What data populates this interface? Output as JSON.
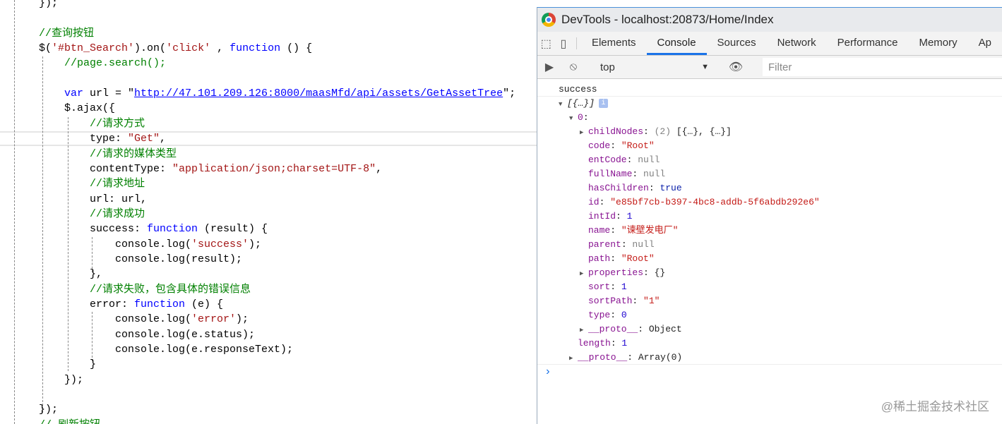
{
  "editor": {
    "lines": [
      {
        "indent": 0,
        "tokens": [
          [
            "",
            "});"
          ]
        ]
      },
      {
        "indent": 0,
        "tokens": []
      },
      {
        "indent": 0,
        "tokens": [
          [
            "cm",
            "//查询按钮"
          ]
        ]
      },
      {
        "indent": 0,
        "tokens": [
          [
            "",
            "$("
          ],
          [
            "str",
            "'#btn_Search'"
          ],
          [
            "",
            ").on("
          ],
          [
            "str",
            "'click'"
          ],
          [
            "",
            " , "
          ],
          [
            "kw",
            "function"
          ],
          [
            "",
            " () {"
          ]
        ]
      },
      {
        "indent": 1,
        "tokens": [
          [
            "cm",
            "//page.search();"
          ]
        ]
      },
      {
        "indent": 1,
        "tokens": []
      },
      {
        "indent": 1,
        "tokens": [
          [
            "kw",
            "var"
          ],
          [
            "",
            " url = \""
          ],
          [
            "url",
            "http://47.101.209.126:8000/maasMfd/api/assets/GetAssetTree"
          ],
          [
            "",
            "\";"
          ]
        ]
      },
      {
        "indent": 1,
        "tokens": [
          [
            "",
            "$.ajax({"
          ]
        ]
      },
      {
        "indent": 2,
        "tokens": [
          [
            "cm",
            "//请求方式"
          ]
        ]
      },
      {
        "indent": 2,
        "tokens": [
          [
            "",
            "type: "
          ],
          [
            "str",
            "\"Get\""
          ],
          [
            "",
            ","
          ]
        ]
      },
      {
        "indent": 2,
        "tokens": [
          [
            "cm",
            "//请求的媒体类型"
          ]
        ]
      },
      {
        "indent": 2,
        "tokens": [
          [
            "",
            "contentType: "
          ],
          [
            "str",
            "\"application/json;charset=UTF-8\""
          ],
          [
            "",
            ","
          ]
        ]
      },
      {
        "indent": 2,
        "tokens": [
          [
            "cm",
            "//请求地址"
          ]
        ]
      },
      {
        "indent": 2,
        "tokens": [
          [
            "",
            "url: url,"
          ]
        ]
      },
      {
        "indent": 2,
        "tokens": [
          [
            "cm",
            "//请求成功"
          ]
        ]
      },
      {
        "indent": 2,
        "tokens": [
          [
            "",
            "success: "
          ],
          [
            "kw",
            "function"
          ],
          [
            "",
            " (result) {"
          ]
        ]
      },
      {
        "indent": 3,
        "tokens": [
          [
            "",
            "console.log("
          ],
          [
            "str",
            "'success'"
          ],
          [
            "",
            ");"
          ]
        ]
      },
      {
        "indent": 3,
        "tokens": [
          [
            "",
            "console.log(result);"
          ]
        ]
      },
      {
        "indent": 2,
        "tokens": [
          [
            "",
            "},"
          ]
        ]
      },
      {
        "indent": 2,
        "tokens": [
          [
            "cm",
            "//请求失败，包含具体的错误信息"
          ]
        ]
      },
      {
        "indent": 2,
        "tokens": [
          [
            "",
            "error: "
          ],
          [
            "kw",
            "function"
          ],
          [
            "",
            " (e) {"
          ]
        ]
      },
      {
        "indent": 3,
        "tokens": [
          [
            "",
            "console.log("
          ],
          [
            "str",
            "'error'"
          ],
          [
            "",
            ");"
          ]
        ]
      },
      {
        "indent": 3,
        "tokens": [
          [
            "",
            "console.log(e.status);"
          ]
        ]
      },
      {
        "indent": 3,
        "tokens": [
          [
            "",
            "console.log(e.responseText);"
          ]
        ]
      },
      {
        "indent": 2,
        "tokens": [
          [
            "",
            "}"
          ]
        ]
      },
      {
        "indent": 1,
        "tokens": [
          [
            "",
            "});"
          ]
        ]
      },
      {
        "indent": 1,
        "tokens": []
      },
      {
        "indent": 0,
        "tokens": [
          [
            "",
            "});"
          ]
        ]
      },
      {
        "indent": 0,
        "tokens": [
          [
            "cm",
            "// 刷新按钮"
          ]
        ]
      }
    ]
  },
  "devtools": {
    "title": "DevTools - localhost:20873/Home/Index",
    "tabs": [
      "Elements",
      "Console",
      "Sources",
      "Network",
      "Performance",
      "Memory",
      "Ap"
    ],
    "active_tab": "Console",
    "context": "top",
    "filter_placeholder": "Filter",
    "console": [
      {
        "indent": 0,
        "tokens": [
          [
            "",
            "success"
          ]
        ],
        "sep": true
      },
      {
        "indent": 1,
        "tri": "▼",
        "tokens": [
          [
            "",
            "[{…}]"
          ]
        ],
        "info": "i"
      },
      {
        "indent": 2,
        "tri": "▼",
        "tokens": [
          [
            "k",
            "0"
          ],
          [
            "",
            ":"
          ]
        ]
      },
      {
        "indent": 3,
        "tri": "▶",
        "tokens": [
          [
            "k",
            "childNodes"
          ],
          [
            "",
            ": "
          ],
          [
            "nl",
            "(2)"
          ],
          [
            "",
            " [{…}, {…}]"
          ]
        ]
      },
      {
        "indent": 3,
        "tokens": [
          [
            "k",
            "code"
          ],
          [
            "",
            ": "
          ],
          [
            "s",
            "\"Root\""
          ]
        ]
      },
      {
        "indent": 3,
        "tokens": [
          [
            "k",
            "entCode"
          ],
          [
            "",
            ": "
          ],
          [
            "nl",
            "null"
          ]
        ]
      },
      {
        "indent": 3,
        "tokens": [
          [
            "k",
            "fullName"
          ],
          [
            "",
            ": "
          ],
          [
            "nl",
            "null"
          ]
        ]
      },
      {
        "indent": 3,
        "tokens": [
          [
            "k",
            "hasChildren"
          ],
          [
            "",
            ": "
          ],
          [
            "b",
            "true"
          ]
        ]
      },
      {
        "indent": 3,
        "tokens": [
          [
            "k",
            "id"
          ],
          [
            "",
            ": "
          ],
          [
            "s",
            "\"e85bf7cb-b397-4bc8-addb-5f6abdb292e6\""
          ]
        ]
      },
      {
        "indent": 3,
        "tokens": [
          [
            "k",
            "intId"
          ],
          [
            "",
            ": "
          ],
          [
            "n",
            "1"
          ]
        ]
      },
      {
        "indent": 3,
        "tokens": [
          [
            "k",
            "name"
          ],
          [
            "",
            ": "
          ],
          [
            "s",
            "\"谏壁发电厂\""
          ]
        ]
      },
      {
        "indent": 3,
        "tokens": [
          [
            "k",
            "parent"
          ],
          [
            "",
            ": "
          ],
          [
            "nl",
            "null"
          ]
        ]
      },
      {
        "indent": 3,
        "tokens": [
          [
            "k",
            "path"
          ],
          [
            "",
            ": "
          ],
          [
            "s",
            "\"Root\""
          ]
        ]
      },
      {
        "indent": 3,
        "tri": "▶",
        "tokens": [
          [
            "k",
            "properties"
          ],
          [
            "",
            ": {}"
          ]
        ]
      },
      {
        "indent": 3,
        "tokens": [
          [
            "k",
            "sort"
          ],
          [
            "",
            ": "
          ],
          [
            "n",
            "1"
          ]
        ]
      },
      {
        "indent": 3,
        "tokens": [
          [
            "k",
            "sortPath"
          ],
          [
            "",
            ": "
          ],
          [
            "s",
            "\"1\""
          ]
        ]
      },
      {
        "indent": 3,
        "tokens": [
          [
            "k",
            "type"
          ],
          [
            "",
            ": "
          ],
          [
            "n",
            "0"
          ]
        ]
      },
      {
        "indent": 3,
        "tri": "▶",
        "tokens": [
          [
            "k",
            "__proto__"
          ],
          [
            "",
            ": Object"
          ]
        ]
      },
      {
        "indent": 2,
        "tokens": [
          [
            "k",
            "length"
          ],
          [
            "",
            ": "
          ],
          [
            "n",
            "1"
          ]
        ]
      },
      {
        "indent": 2,
        "tri": "▶",
        "tokens": [
          [
            "k",
            "__proto__"
          ],
          [
            "",
            ": Array(0)"
          ]
        ],
        "sep": true
      }
    ],
    "prompt": "›"
  },
  "watermark": "@稀土掘金技术社区"
}
